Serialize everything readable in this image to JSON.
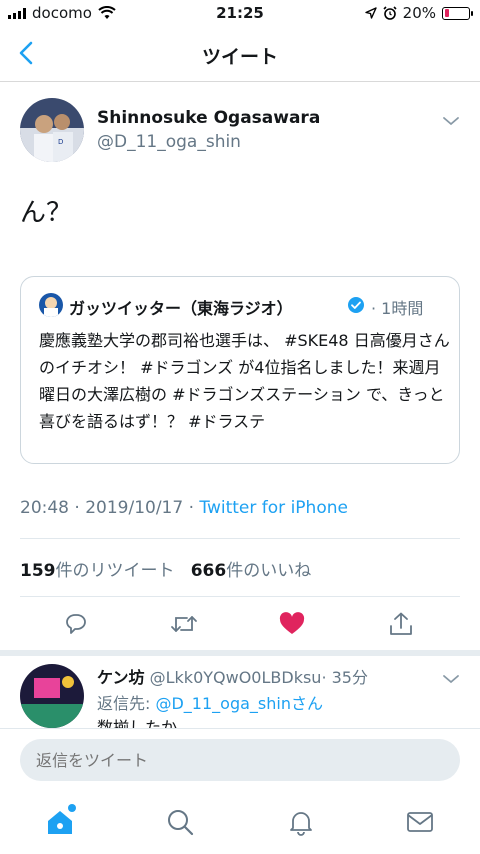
{
  "status_bar": {
    "carrier": "docomo",
    "time": "21:25",
    "battery": "20%",
    "battery_level": 0.2,
    "icons": [
      "signal-icon",
      "wifi-icon",
      "location-icon",
      "alarm-icon",
      "battery-icon"
    ]
  },
  "nav": {
    "title": "ツイート",
    "back_icon": "chevron-left-icon"
  },
  "tweet": {
    "name": "Shinnosuke Ogasawara",
    "handle": "@D_11_oga_shin",
    "text": "ん？",
    "quote": {
      "name": "ガッツイッター（東海ラジオ）",
      "time": "1時間",
      "text": "慶應義塾大学の郡司裕也選手は、 #SKE48 日高優月さんのイチオシ！ #ドラゴンズ が4位指名しました！来週月曜日の大澤広樹の #ドラゴンズステーション で、きっと喜びを語るはず！？ #ドラステ"
    },
    "timestamp": "20:48 · 2019/10/17 · ",
    "source": "Twitter for iPhone",
    "retweet_count": "159",
    "retweet_label": "件のリツイート",
    "like_count": "666",
    "like_label": "件のいいね",
    "liked": true
  },
  "reply": {
    "name": "ケン坊",
    "handle": "@Lkk0YQwO0LBDksu",
    "time": "· 35分",
    "to_prefix": "返信先: ",
    "to_handle": "@D_11_oga_shinさん",
    "text": "数揃したか"
  },
  "composer": {
    "placeholder": "返信をツイート"
  },
  "colors": {
    "accent": "#1da1f2",
    "like": "#e0245e",
    "secondary_text": "#657786"
  }
}
